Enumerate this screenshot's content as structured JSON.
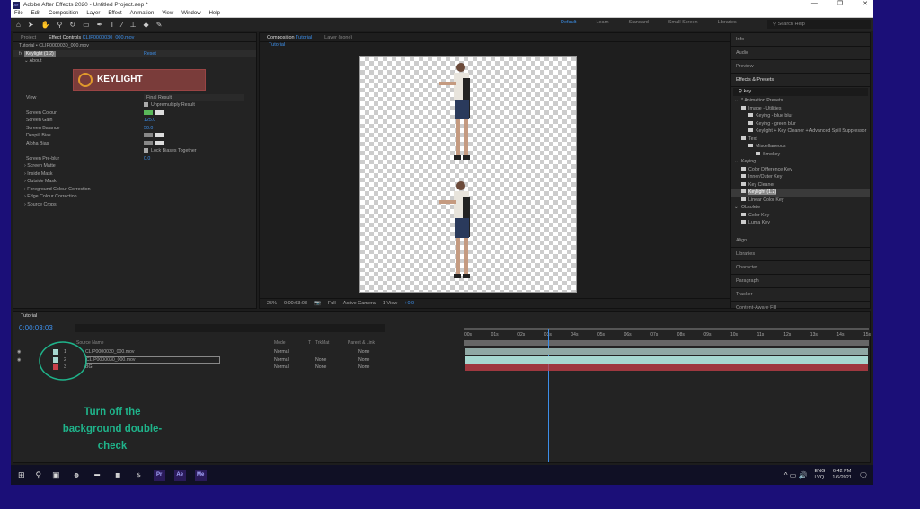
{
  "window": {
    "title": "Adobe After Effects 2020 - Untitled Project.aep *",
    "app_badge": "Ae",
    "min": "—",
    "max": "❐",
    "close": "✕"
  },
  "menu": [
    "File",
    "Edit",
    "Composition",
    "Layer",
    "Effect",
    "Animation",
    "View",
    "Window",
    "Help"
  ],
  "workspaces": {
    "default": "Default",
    "items": [
      "Learn",
      "Standard",
      "Small Screen",
      "Libraries"
    ],
    "search_placeholder": "Search Help"
  },
  "effect_controls": {
    "tab_project": "Project",
    "tab_label": "Effect Controls",
    "tab_file": "CLIP0000030_000.mov",
    "breadcrumb": "Tutorial • CLIP0000030_000.mov",
    "effect_name": "Keylight (1.2)",
    "reset": "Reset",
    "about": "About",
    "logo_text": "KEYLIGHT",
    "props": [
      {
        "label": "View",
        "value": "Final Result"
      },
      {
        "label": "",
        "value": "Unpremultiply Result"
      },
      {
        "label": "Screen Colour",
        "value": ""
      },
      {
        "label": "Screen Gain",
        "value": "125.0"
      },
      {
        "label": "Screen Balance",
        "value": "50.0"
      },
      {
        "label": "Despill Bias",
        "value": ""
      },
      {
        "label": "Alpha Bias",
        "value": ""
      },
      {
        "label": "",
        "value": "Lock Biases Together"
      },
      {
        "label": "Screen Pre-blur",
        "value": "0.0"
      }
    ],
    "groups": [
      "Screen Matte",
      "Inside Mask",
      "Outside Mask",
      "Foreground Colour Correction",
      "Edge Colour Correction",
      "Source Crops"
    ]
  },
  "composition": {
    "tab": "Composition",
    "tab_name": "Tutorial",
    "layer_tab": "Layer (none)",
    "sub_tab": "Tutorial",
    "zoom": "25%",
    "time": "0:00:03:03",
    "resolution": "Full",
    "camera": "Active Camera",
    "views": "1 View",
    "exposure": "+0.0"
  },
  "right_panels": {
    "top": [
      "Info",
      "Audio",
      "Preview"
    ],
    "effects_title": "Effects & Presets",
    "search_value": "key",
    "tree": [
      {
        "label": "* Animation Presets",
        "level": 0,
        "type": "group"
      },
      {
        "label": "Image - Utilities",
        "level": 1,
        "type": "folder"
      },
      {
        "label": "Keying - blue blur",
        "level": 2,
        "type": "preset"
      },
      {
        "label": "Keying - green blur",
        "level": 2,
        "type": "preset"
      },
      {
        "label": "Keylight + Key Cleaner + Advanced Spill Suppressor",
        "level": 2,
        "type": "preset"
      },
      {
        "label": "Text",
        "level": 1,
        "type": "folder"
      },
      {
        "label": "Miscellaneous",
        "level": 2,
        "type": "folder"
      },
      {
        "label": "Smokey",
        "level": 3,
        "type": "preset"
      },
      {
        "label": "Keying",
        "level": 0,
        "type": "group"
      },
      {
        "label": "Color Difference Key",
        "level": 1,
        "type": "effect"
      },
      {
        "label": "Inner/Outer Key",
        "level": 1,
        "type": "effect"
      },
      {
        "label": "Key Cleaner",
        "level": 1,
        "type": "effect"
      },
      {
        "label": "Keylight (1.2)",
        "level": 1,
        "type": "effect",
        "selected": true
      },
      {
        "label": "Linear Color Key",
        "level": 1,
        "type": "effect"
      },
      {
        "label": "Obsolete",
        "level": 0,
        "type": "group"
      },
      {
        "label": "Color Key",
        "level": 1,
        "type": "effect"
      },
      {
        "label": "Luma Key",
        "level": 1,
        "type": "effect"
      }
    ],
    "bottom": [
      "Align",
      "Libraries",
      "Character",
      "Paragraph",
      "Tracker",
      "Content-Aware Fill"
    ]
  },
  "timeline": {
    "tab": "Tutorial",
    "timecode": "0:00:03:03",
    "cols": {
      "source": "Source Name",
      "mode": "Mode",
      "t": "T",
      "trkmat": "TrkMat",
      "parent": "Parent & Link"
    },
    "layers": [
      {
        "num": "1",
        "name": "CLIP0000030_000.mov",
        "mode": "Normal",
        "trkmat": "",
        "parent": "None",
        "color": "#a6d8d0"
      },
      {
        "num": "2",
        "name": "CLIP0000030_000.mov",
        "mode": "Normal",
        "trkmat": "None",
        "parent": "None",
        "color": "#a6d8d0"
      },
      {
        "num": "3",
        "name": "BG",
        "mode": "Normal",
        "trkmat": "None",
        "parent": "None",
        "color": "#c8404a"
      }
    ],
    "ruler": [
      "00s",
      "01s",
      "02s",
      "03s",
      "04s",
      "05s",
      "06s",
      "07s",
      "08s",
      "09s",
      "10s",
      "11s",
      "12s",
      "13s",
      "14s",
      "15s"
    ],
    "playhead_seconds": 3.1
  },
  "annotation": "Turn off the background double-check",
  "taskbar": {
    "apps": [
      "Chrome",
      "Files",
      "Calc",
      "Steam",
      "Pr",
      "Ae",
      "Me"
    ],
    "lang1": "ENG",
    "lang2": "LVQ",
    "time": "6:42 PM",
    "date": "1/6/2021"
  },
  "colors": {
    "accent": "#3d8ee8",
    "annotation": "#1fb38a",
    "bg_layer": "#c8404a",
    "clip_layer": "#a6d8d0"
  }
}
